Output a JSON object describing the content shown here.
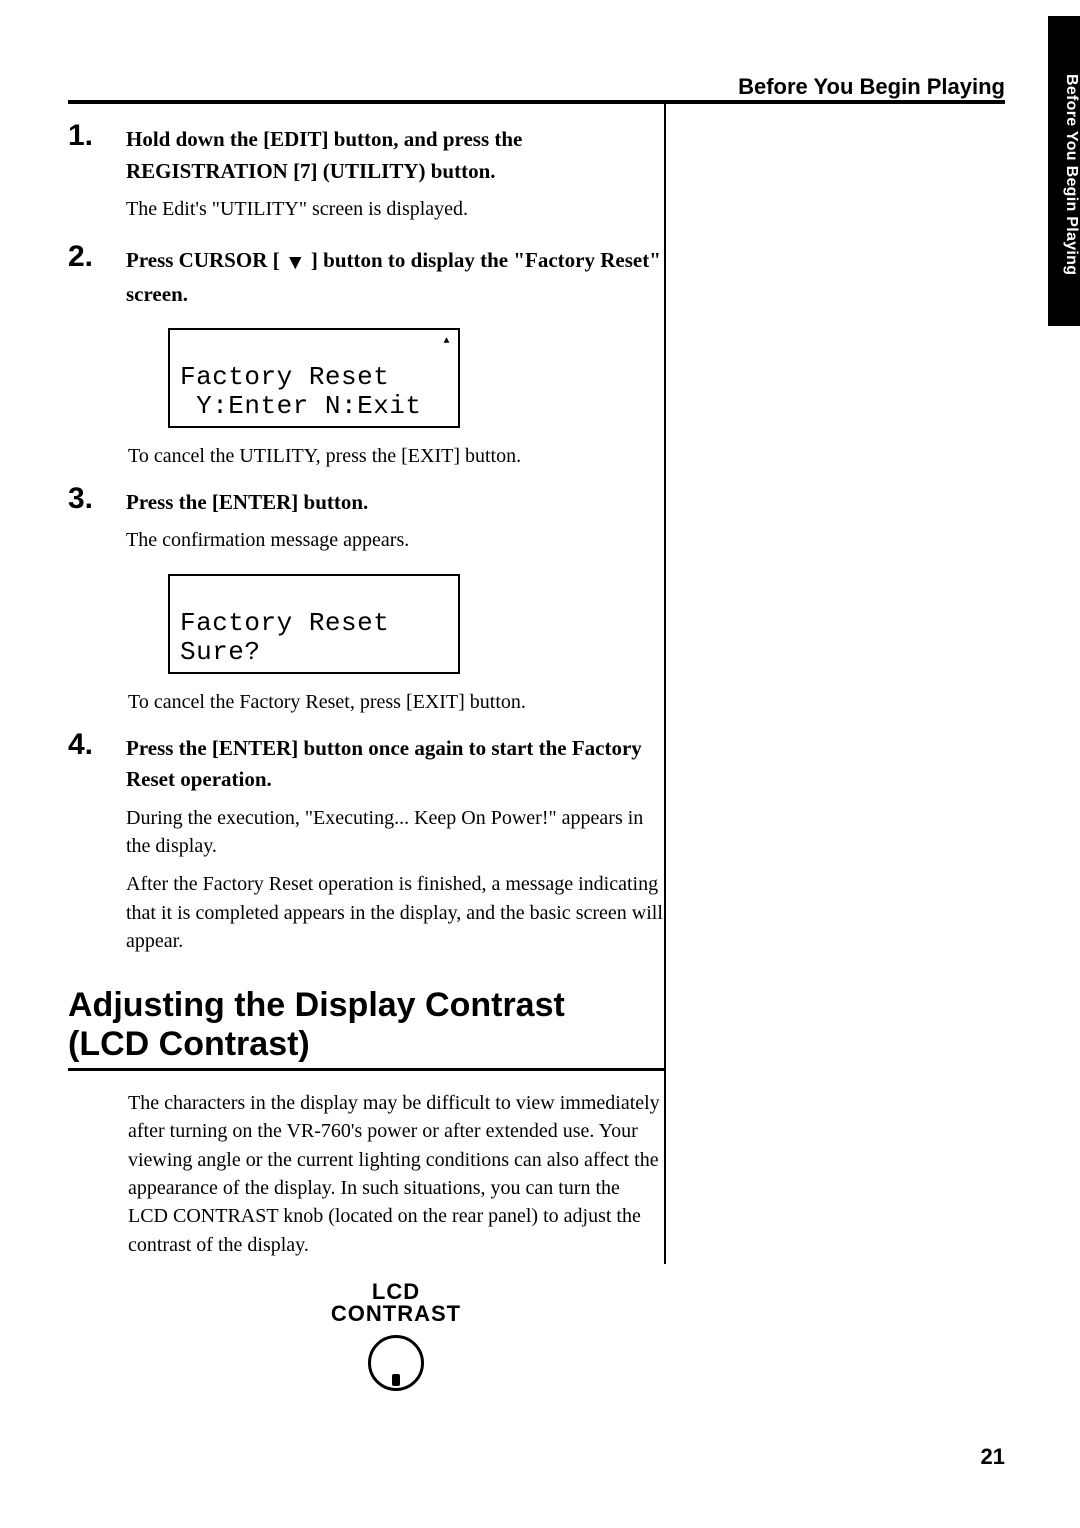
{
  "side_tab": "Before You Begin Playing",
  "running_header": "Before You Begin Playing",
  "page_number": "21",
  "steps": [
    {
      "num": "1.",
      "title": "Hold down the [EDIT] button, and press the REGISTRATION [7] (UTILITY) button.",
      "desc_after": "The Edit's \"UTILITY\" screen is displayed."
    },
    {
      "num": "2.",
      "title_before": "Press CURSOR [ ",
      "title_after": " ] button to display the \"Factory Reset\" screen.",
      "lcd_line1": "Factory Reset",
      "lcd_line2": " Y:Enter N:Exit",
      "desc_after": "To cancel the UTILITY, press the [EXIT] button."
    },
    {
      "num": "3.",
      "title": "Press the [ENTER] button.",
      "desc_before": "The confirmation message appears.",
      "lcd_line1": "Factory Reset",
      "lcd_line2": "Sure?",
      "desc_after": "To cancel the Factory Reset, press [EXIT] button."
    },
    {
      "num": "4.",
      "title": "Press the [ENTER] button once again to start the Factory Reset operation.",
      "desc1": "During the execution, \"Executing... Keep On Power!\" appears in the display.",
      "desc2": "After the Factory Reset operation is finished, a message indicating that it is completed appears in the display, and the basic screen will appear."
    }
  ],
  "section2": {
    "title_line1": "Adjusting the Display Contrast",
    "title_line2": "(LCD Contrast)",
    "body": "The characters in the display may be difficult to view immediately after turning on the VR-760's power or after extended use. Your viewing angle or the current lighting conditions can also affect the appearance of the display. In such situations, you can turn the LCD CONTRAST knob (located on the rear panel) to adjust the contrast of the display.",
    "knob_label_line1": "LCD",
    "knob_label_line2": "CONTRAST"
  }
}
